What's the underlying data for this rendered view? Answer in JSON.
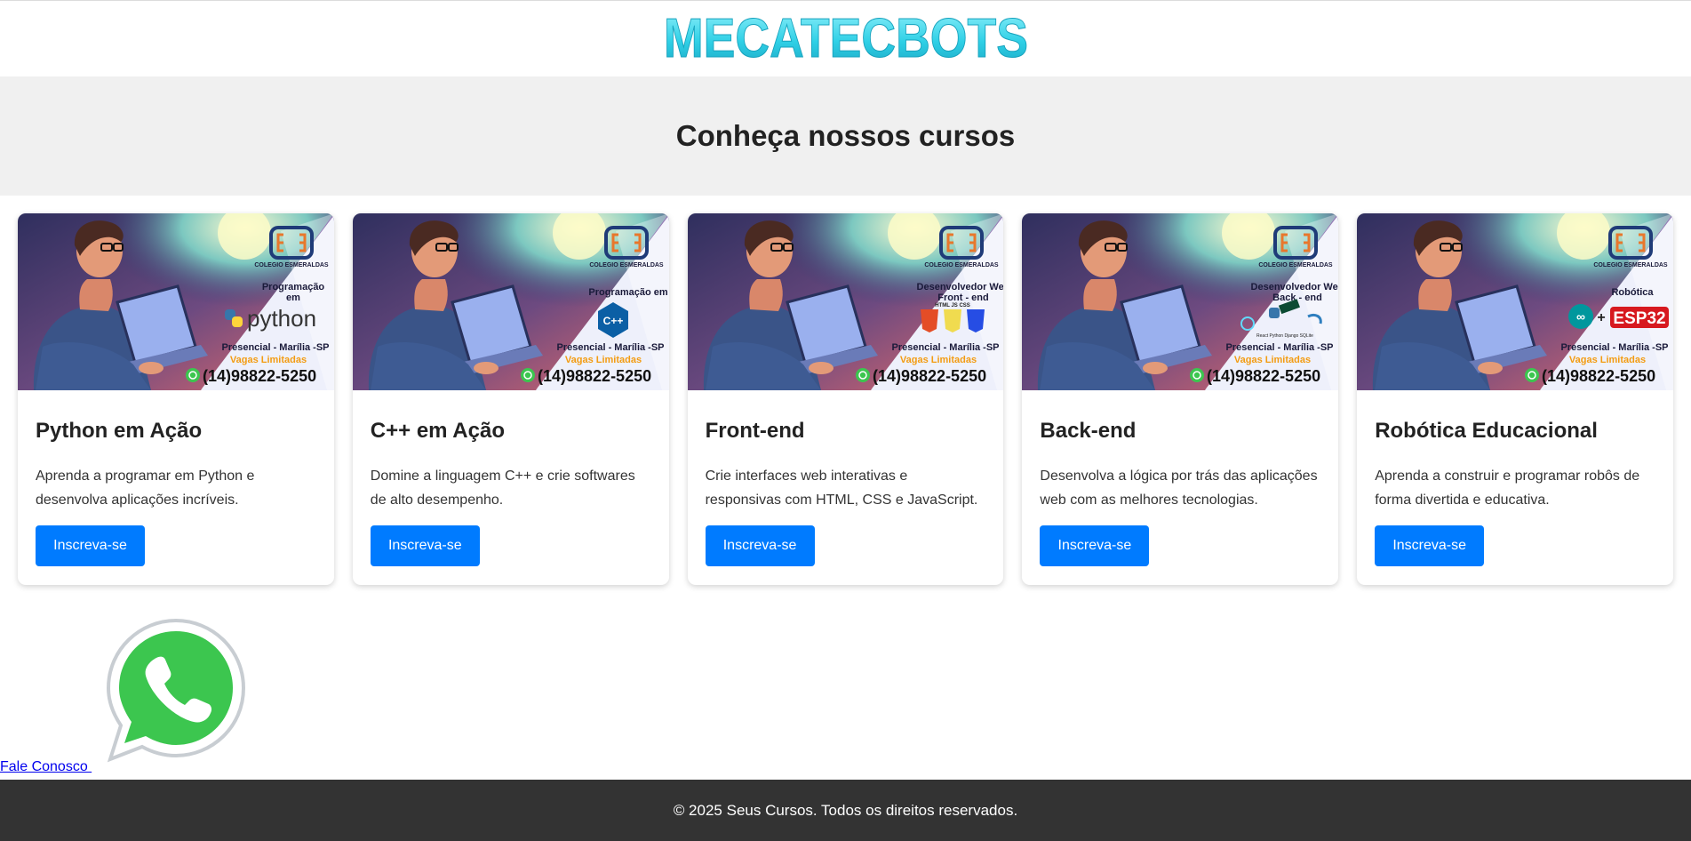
{
  "logo": {
    "text": "MECATECBOTS"
  },
  "hero": {
    "title": "Conheça nossos cursos"
  },
  "colors": {
    "accent": "#007bff",
    "hero_bg": "#f0f0f0",
    "footer_bg": "#333333",
    "logo_cyan": "#2fd0e6",
    "whatsapp_green": "#3cc64f"
  },
  "courses": [
    {
      "title": "Python em Ação",
      "description": "Aprenda a programar em Python e desenvolva aplicações incríveis.",
      "button": "Inscreva-se",
      "banner": {
        "school": "COLEGIO ESMERALDAS",
        "heading": [
          "Programação",
          "em"
        ],
        "tech": "python",
        "location": "Presencial - Marília -SP",
        "vagas": "Vagas Limitadas",
        "phone": "(14)98822-5250"
      }
    },
    {
      "title": "C++ em Ação",
      "description": "Domine a linguagem C++ e crie softwares de alto desempenho.",
      "button": "Inscreva-se",
      "banner": {
        "school": "COLEGIO ESMERALDAS",
        "heading": [
          "Programação em"
        ],
        "tech": "C++",
        "location": "Presencial - Marília -SP",
        "vagas": "Vagas Limitadas",
        "phone": "(14)98822-5250"
      }
    },
    {
      "title": "Front-end",
      "description": "Crie interfaces web interativas e responsivas com HTML, CSS e JavaScript.",
      "button": "Inscreva-se",
      "banner": {
        "school": "COLEGIO ESMERALDAS",
        "heading": [
          "Desenvolvedor Web",
          "Front - end"
        ],
        "tech": "HTML JS CSS",
        "location": "Presencial - Marília -SP",
        "vagas": "Vagas Limitadas",
        "phone": "(14)98822-5250"
      }
    },
    {
      "title": "Back-end",
      "description": "Desenvolva a lógica por trás das aplicações web com as melhores tecnologias.",
      "button": "Inscreva-se",
      "banner": {
        "school": "COLEGIO ESMERALDAS",
        "heading": [
          "Desenvolvedor Web",
          "Back - end"
        ],
        "tech": "React Python Django SQLite",
        "location": "Presencial - Marília -SP",
        "vagas": "Vagas Limitadas",
        "phone": "(14)98822-5250"
      }
    },
    {
      "title": "Robótica Educacional",
      "description": "Aprenda a construir e programar robôs de forma divertida e educativa.",
      "button": "Inscreva-se",
      "banner": {
        "school": "COLEGIO ESMERALDAS",
        "heading": [
          "Robótica"
        ],
        "tech": "ESP32",
        "location": "Presencial - Marília -SP",
        "vagas": "Vagas Limitadas",
        "phone": "(14)98822-5250"
      }
    }
  ],
  "whatsapp": {
    "icon": "whatsapp-icon",
    "link_text": "Fale Conosco "
  },
  "footer": {
    "text": "© 2025 Seus Cursos. Todos os direitos reservados."
  }
}
